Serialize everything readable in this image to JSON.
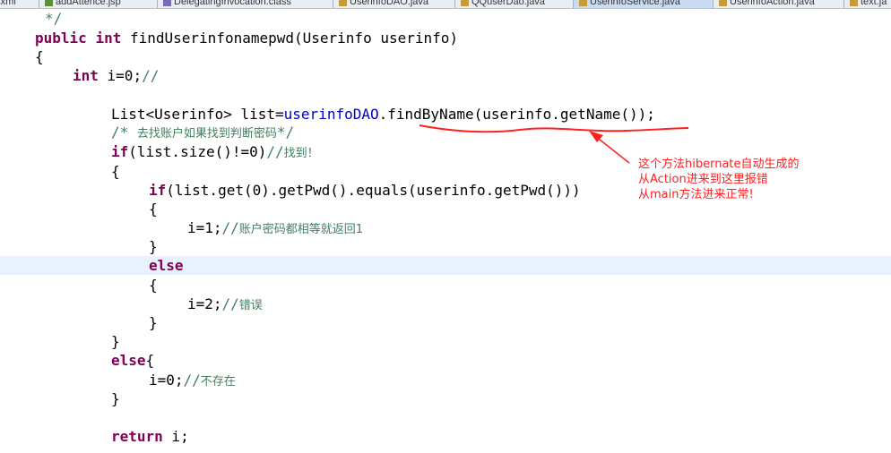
{
  "tabs": [
    {
      "label": "atsxml",
      "active": false
    },
    {
      "label": "addAttence.jsp",
      "active": false
    },
    {
      "label": "DelegatingInvocation.class",
      "active": false
    },
    {
      "label": "UserinfoDAO.java",
      "active": false
    },
    {
      "label": "QQuserDao.java",
      "active": false
    },
    {
      "label": "UserinfoService.java",
      "active": true
    },
    {
      "label": "UserinfoAction.java",
      "active": false
    },
    {
      "label": "text.ja",
      "active": false
    }
  ],
  "code": {
    "l1": "*/",
    "l2_kw1": "public",
    "l2_kw2": "int",
    "l2_rest": " findUserinfonamepwd(Userinfo userinfo)",
    "l3": "{",
    "l4_kw": "int",
    "l4_code": " i=0;",
    "l4_cm": "//",
    "l5_a": "List<Userinfo> list=",
    "l5_field": "userinfoDAO",
    "l5_b": ".findByName(userinfo.getName());",
    "l6_cm": "/* ",
    "l6_zh": "去找账户如果找到判断密码",
    "l6_end": "*/",
    "l7_kw": "if",
    "l7_code": "(list.size()!=0)",
    "l7_cm": "//",
    "l7_zh": "找到！",
    "l8": "{",
    "l9_kw": "if",
    "l9_code": "(list.get(0).getPwd().equals(userinfo.getPwd()))",
    "l10": "{",
    "l11_code": "i=1;",
    "l11_cm": "//",
    "l11_zh": "账户密码都相等就返回1",
    "l12": "}",
    "l13_kw": "else",
    "l14": "{",
    "l15_code": "i=2;",
    "l15_cm": "//",
    "l15_zh": "错误",
    "l16": "}",
    "l17": "}",
    "l18_kw": "else",
    "l18_code": "{",
    "l19_code": "i=0;",
    "l19_cm": "//",
    "l19_zh": "不存在",
    "l20": "}",
    "l21_kw": "return",
    "l21_code": " i;"
  },
  "annotation": {
    "line1": "这个方法hibernate自动生成的",
    "line2": "从Action进来到这里报错",
    "line3": "从main方法进来正常!"
  },
  "colors": {
    "keyword": "#7f0055",
    "comment": "#3f7f5f",
    "field": "#0000c0",
    "annotation": "#ff2020",
    "current_line": "#e8f2fe"
  }
}
